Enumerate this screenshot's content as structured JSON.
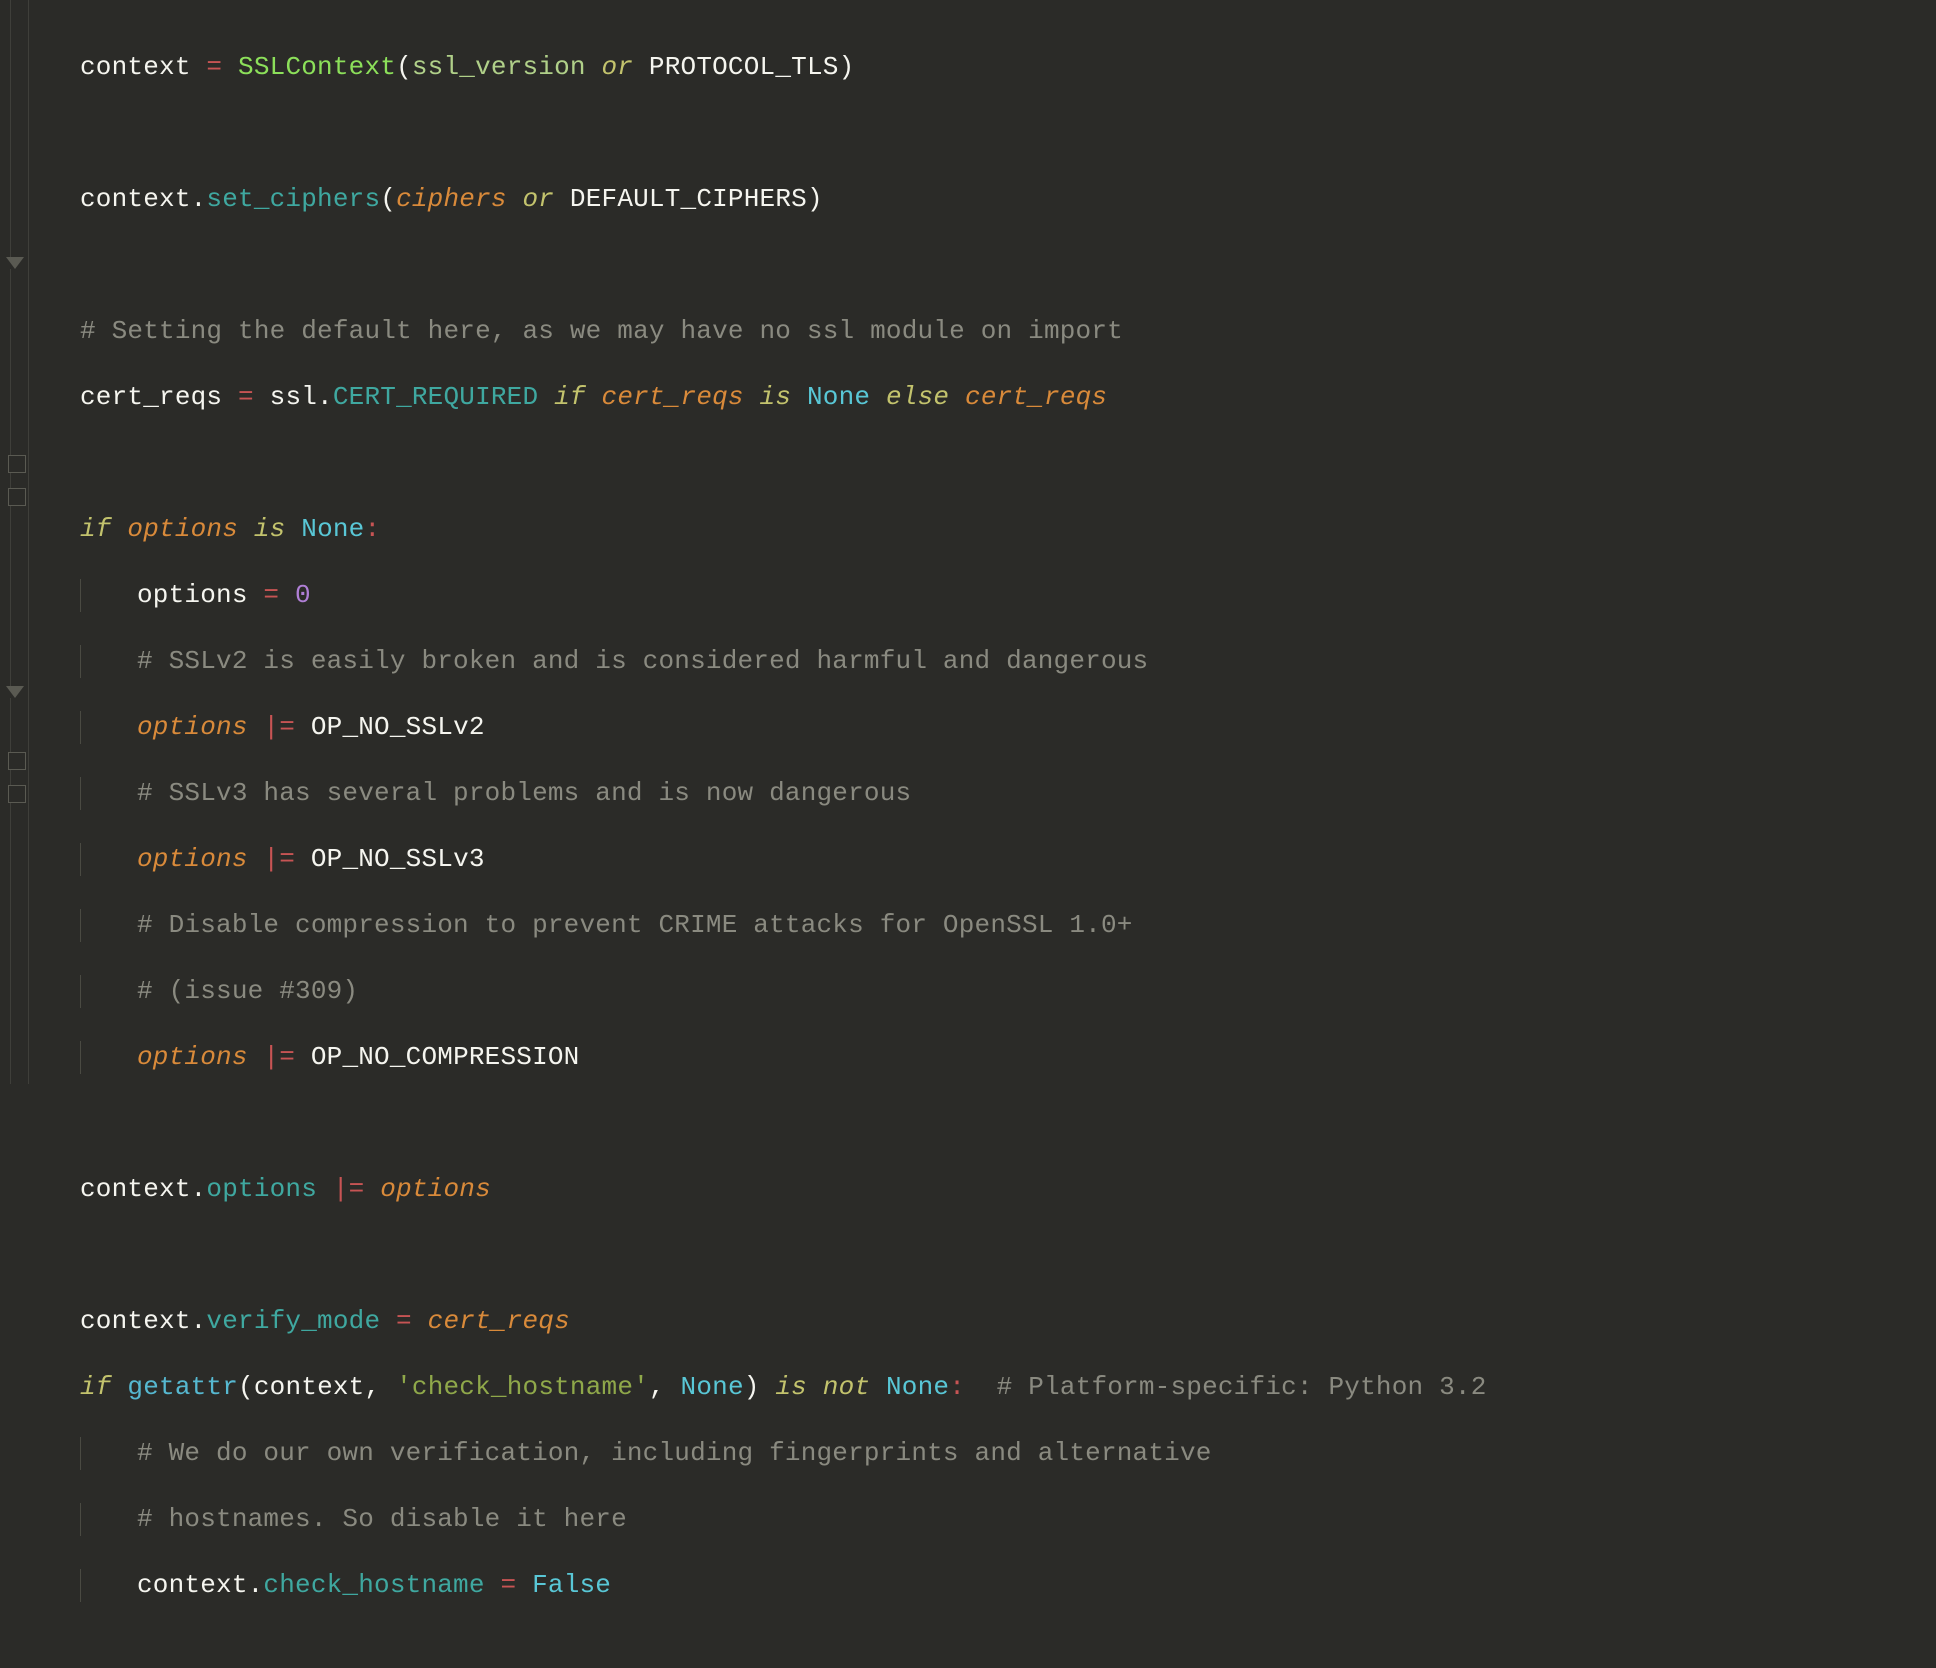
{
  "code": {
    "l1": {
      "a": "context ",
      "b": "= ",
      "c": "SSLContext",
      "d": "(",
      "e": "ssl_version",
      "f": " or ",
      "g": "PROTOCOL_TLS",
      "h": ")"
    },
    "l3": {
      "a": "context.",
      "b": "set_ciphers",
      "c": "(",
      "d": "ciphers",
      "e": " or ",
      "f": "DEFAULT_CIPHERS",
      "g": ")"
    },
    "l5": "# Setting the default here, as we may have no ssl module on import",
    "l6": {
      "a": "cert_reqs ",
      "b": "= ",
      "c": "ssl.",
      "d": "CERT_REQUIRED",
      "e": " if ",
      "f": "cert_reqs",
      "g": " is ",
      "h": "None",
      "i": " else ",
      "j": "cert_reqs"
    },
    "l8": {
      "a": "if ",
      "b": "options",
      "c": " is ",
      "d": "None",
      "e": ":"
    },
    "l9": {
      "a": "options ",
      "b": "= ",
      "c": "0"
    },
    "l10": "# SSLv2 is easily broken and is considered harmful and dangerous",
    "l11": {
      "a": "options",
      "b": " |= ",
      "c": "OP_NO_SSLv2"
    },
    "l12": "# SSLv3 has several problems and is now dangerous",
    "l13": {
      "a": "options",
      "b": " |= ",
      "c": "OP_NO_SSLv3"
    },
    "l14": "# Disable compression to prevent CRIME attacks for OpenSSL 1.0+",
    "l15": "# (issue #309)",
    "l16": {
      "a": "options",
      "b": " |= ",
      "c": "OP_NO_COMPRESSION"
    },
    "l18": {
      "a": "context.",
      "b": "options",
      "c": " |= ",
      "d": "options"
    },
    "l20": {
      "a": "context.",
      "b": "verify_mode",
      "c": " = ",
      "d": "cert_reqs"
    },
    "l21": {
      "a": "if ",
      "b": "getattr",
      "c": "(",
      "d": "context",
      "e": ", ",
      "f": "'check_hostname'",
      "g": ", ",
      "h": "None",
      "i": ")",
      "j": " is not ",
      "k": "None",
      "l": ":",
      "m": "  # Platform-specific: Python 3.2"
    },
    "l22": "# We do our own verification, including fingerprints and alternative",
    "l23": "# hostnames. So disable it here",
    "l24": {
      "a": "context.",
      "b": "check_hostname",
      "c": " = ",
      "d": "False"
    }
  }
}
